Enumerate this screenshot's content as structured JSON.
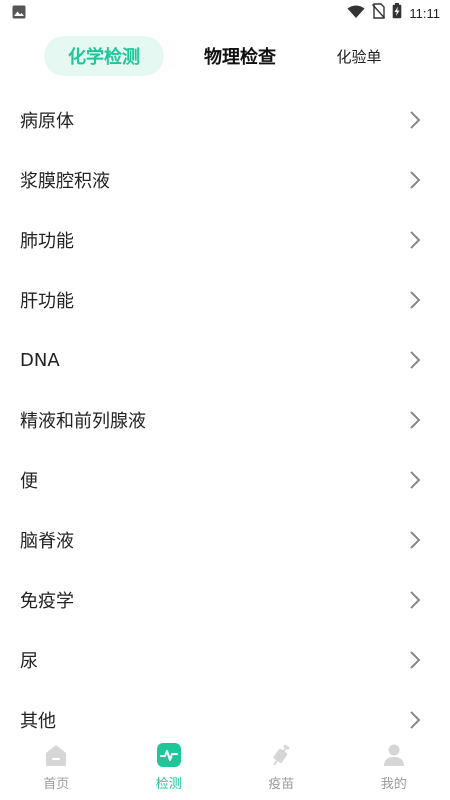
{
  "status_bar": {
    "time": "11:11"
  },
  "tabs": [
    {
      "label": "化学检测",
      "active": true
    },
    {
      "label": "物理检查",
      "active": false
    },
    {
      "label": "化验单",
      "active": false
    }
  ],
  "list": {
    "items": [
      {
        "label": "病原体"
      },
      {
        "label": "浆膜腔积液"
      },
      {
        "label": "肺功能"
      },
      {
        "label": "肝功能"
      },
      {
        "label": "DNA"
      },
      {
        "label": "精液和前列腺液"
      },
      {
        "label": "便"
      },
      {
        "label": "脑脊液"
      },
      {
        "label": "免疫学"
      },
      {
        "label": "尿"
      },
      {
        "label": "其他"
      }
    ]
  },
  "bottom_nav": {
    "items": [
      {
        "label": "首页",
        "icon": "home-icon",
        "active": false
      },
      {
        "label": "检测",
        "icon": "pulse-icon",
        "active": true
      },
      {
        "label": "疫苗",
        "icon": "vaccine-icon",
        "active": false
      },
      {
        "label": "我的",
        "icon": "profile-icon",
        "active": false
      }
    ]
  },
  "colors": {
    "accent": "#1fc69a",
    "accent_bg": "#e6f8f2",
    "inactive": "#9a9a9a"
  }
}
